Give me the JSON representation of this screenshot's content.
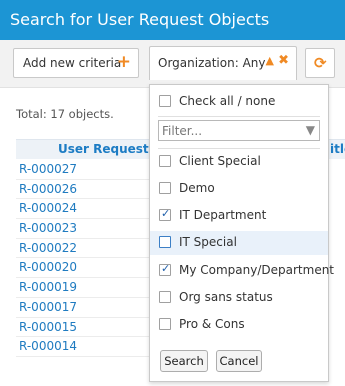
{
  "header": {
    "title": "Search for User Request Objects"
  },
  "toolbar": {
    "add_criteria_label": "Add new criteria",
    "org_filter_label": "Organization: Any"
  },
  "results": {
    "total_text": "Total: 17 objects.",
    "columns": [
      "User Request",
      "itle"
    ],
    "rows": [
      "R-000027",
      "R-000026",
      "R-000024",
      "R-000023",
      "R-000022",
      "R-000020",
      "R-000019",
      "R-000017",
      "R-000015",
      "R-000014"
    ]
  },
  "dropdown": {
    "check_all_label": "Check all / none",
    "filter_placeholder": "Filter...",
    "options": [
      {
        "label": "Client Special",
        "checked": false
      },
      {
        "label": "Demo",
        "checked": false
      },
      {
        "label": "IT Department",
        "checked": true
      },
      {
        "label": "IT Special",
        "checked": false
      },
      {
        "label": "My Company/Department",
        "checked": true
      },
      {
        "label": "Org sans status",
        "checked": false
      },
      {
        "label": "Pro & Cons",
        "checked": false
      }
    ],
    "search_label": "Search",
    "cancel_label": "Cancel"
  },
  "colors": {
    "header_bg": "#1c95d4",
    "accent": "#f08a24",
    "link": "#1f7bc0"
  }
}
